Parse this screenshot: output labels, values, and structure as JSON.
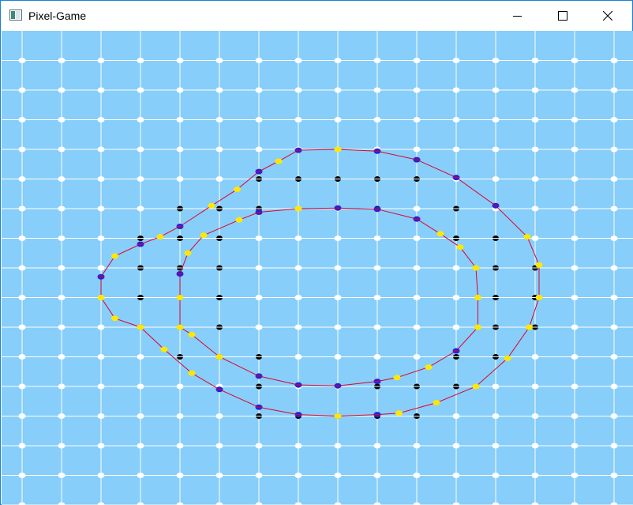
{
  "window": {
    "title": "Pixel-Game",
    "app_icon": "window-app-icon",
    "controls": [
      {
        "name": "minimize",
        "icon": "minimize-icon"
      },
      {
        "name": "maximize",
        "icon": "maximize-icon"
      },
      {
        "name": "close",
        "icon": "close-icon"
      }
    ]
  },
  "colors": {
    "background": "#87cefa",
    "grid": "#ffffff",
    "contour": "#e0002a",
    "inside_point": "#000000",
    "contour_vertex_blue": "#2a1fd6",
    "contour_vertex_yellow": "#ffe800",
    "border": "#1c7fd6"
  },
  "grid": {
    "columns": 16,
    "rows": 16,
    "inside_points": [
      [
        6,
        4
      ],
      [
        7,
        4
      ],
      [
        8,
        4
      ],
      [
        9,
        4
      ],
      [
        10,
        4
      ],
      [
        4,
        5
      ],
      [
        5,
        5
      ],
      [
        6,
        5
      ],
      [
        9,
        5
      ],
      [
        11,
        5
      ],
      [
        3,
        6
      ],
      [
        4,
        6
      ],
      [
        5,
        6
      ],
      [
        11,
        6
      ],
      [
        12,
        6
      ],
      [
        3,
        7
      ],
      [
        4,
        7
      ],
      [
        5,
        7
      ],
      [
        12,
        7
      ],
      [
        13,
        7
      ],
      [
        3,
        8
      ],
      [
        4,
        8
      ],
      [
        5,
        8
      ],
      [
        12,
        8
      ],
      [
        13,
        8
      ],
      [
        3,
        9
      ],
      [
        4,
        9
      ],
      [
        5,
        9
      ],
      [
        12,
        9
      ],
      [
        13,
        9
      ],
      [
        4,
        10
      ],
      [
        5,
        10
      ],
      [
        6,
        10
      ],
      [
        11,
        10
      ],
      [
        12,
        10
      ],
      [
        6,
        11
      ],
      [
        9,
        11
      ],
      [
        10,
        11
      ],
      [
        11,
        11
      ],
      [
        6,
        12
      ],
      [
        7,
        12
      ],
      [
        8,
        12
      ],
      [
        9,
        12
      ],
      [
        10,
        12
      ]
    ]
  },
  "contours": [
    {
      "name": "outer-contour",
      "points": [
        [
          7,
          3.03
        ],
        [
          8,
          3.0
        ],
        [
          9,
          3.06
        ],
        [
          10,
          3.35
        ],
        [
          11,
          3.95
        ],
        [
          12,
          4.9
        ],
        [
          12.8,
          5.95
        ],
        [
          13.1,
          6.9
        ],
        [
          13.1,
          8.0
        ],
        [
          12.85,
          9.0
        ],
        [
          12.3,
          10.05
        ],
        [
          11.5,
          11
        ],
        [
          10.5,
          11.55
        ],
        [
          9.55,
          11.9
        ],
        [
          9,
          11.95
        ],
        [
          8,
          12.0
        ],
        [
          7,
          11.95
        ],
        [
          6,
          11.7
        ],
        [
          5,
          11.1
        ],
        [
          4.3,
          10.55
        ],
        [
          3.6,
          9.75
        ],
        [
          3,
          9.0
        ],
        [
          2.35,
          8.7
        ],
        [
          2.0,
          8.0
        ],
        [
          2.0,
          7.3
        ],
        [
          2.35,
          6.6
        ],
        [
          3,
          6.2
        ],
        [
          3.5,
          5.95
        ],
        [
          4,
          5.6
        ],
        [
          4.8,
          4.9
        ],
        [
          5.45,
          4.35
        ],
        [
          6.0,
          3.75
        ],
        [
          6.5,
          3.4
        ],
        [
          7,
          3.03
        ]
      ]
    },
    {
      "name": "inner-contour",
      "points": [
        [
          8,
          4.98
        ],
        [
          9,
          5.02
        ],
        [
          10,
          5.35
        ],
        [
          10.6,
          5.85
        ],
        [
          11.1,
          6.3
        ],
        [
          11.5,
          7.0
        ],
        [
          11.55,
          8.0
        ],
        [
          11.55,
          9.0
        ],
        [
          11.0,
          9.8
        ],
        [
          10.3,
          10.35
        ],
        [
          9.5,
          10.7
        ],
        [
          9,
          10.83
        ],
        [
          8,
          10.98
        ],
        [
          7,
          10.95
        ],
        [
          6.0,
          10.65
        ],
        [
          5.0,
          10.0
        ],
        [
          4.3,
          9.25
        ],
        [
          4.0,
          9.0
        ],
        [
          4.0,
          8.0
        ],
        [
          4.0,
          7.2
        ],
        [
          4.2,
          6.5
        ],
        [
          4.6,
          5.9
        ],
        [
          5.5,
          5.38
        ],
        [
          6.0,
          5.12
        ],
        [
          7,
          5.0
        ],
        [
          8,
          4.98
        ]
      ]
    }
  ]
}
